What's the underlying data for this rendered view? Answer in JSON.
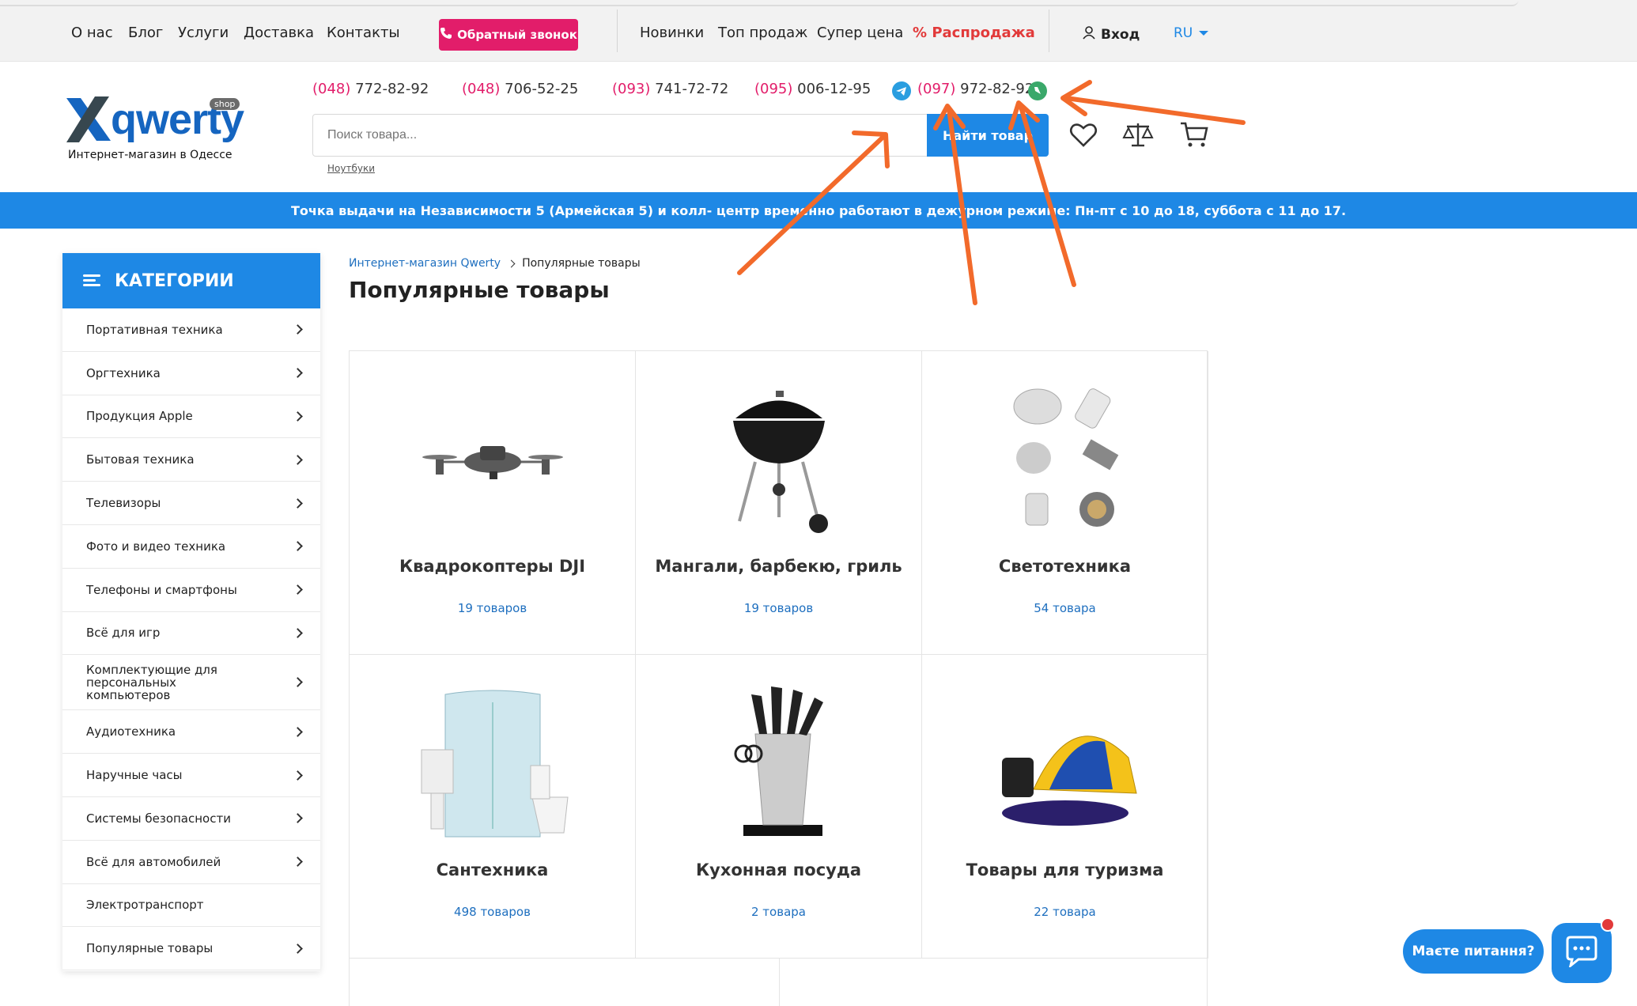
{
  "topnav": {
    "links": [
      "О нас",
      "Блог",
      "Услуги",
      "Доставка",
      "Контакты"
    ],
    "callback": "Обратный звонок",
    "links2": [
      "Новинки",
      "Топ продаж",
      "Супер цена"
    ],
    "sale": "Распродажа",
    "login": "Вход",
    "lang": "RU"
  },
  "logo": {
    "brand": "qwerty",
    "shop": "shop",
    "tagline": "Интернет-магазин в Одессе"
  },
  "phones": [
    {
      "code": "(048)",
      "number": " 772-82-92"
    },
    {
      "code": "(048)",
      "number": " 706-52-25"
    },
    {
      "code": "(093)",
      "number": " 741-72-72"
    },
    {
      "code": "(095)",
      "number": " 006-12-95"
    },
    {
      "code": "(097)",
      "number": " 972-82-92"
    }
  ],
  "search": {
    "placeholder": "Поиск товара...",
    "button": "Найти товар",
    "hint": "Ноутбуки"
  },
  "banner": "Точка выдачи на Независимости 5 (Армейская 5) и колл- центр временно работают в дежурном режиме: Пн-пт с 10 до 18, суббота с 11 до 17.",
  "sidebar": {
    "title": "КАТЕГОРИИ",
    "items": [
      "Портативная техника",
      "Оргтехника",
      "Продукция Apple",
      "Бытовая техника",
      "Телевизоры",
      "Фото и видео техника",
      "Телефоны и смартфоны",
      "Всё для игр",
      "Комплектующие для персональных компьютеров",
      "Аудиотехника",
      "Наручные часы",
      "Системы безопасности",
      "Всё для автомобилей",
      "Электротранспорт",
      "Популярные товары"
    ]
  },
  "breadcrumb": {
    "home": "Интернет-магазин Qwerty",
    "current": "Популярные товары"
  },
  "page_title": "Популярные товары",
  "cards": [
    {
      "name": "Квадрокоптеры DJI",
      "count": "19 товаров",
      "icon": "drone-image"
    },
    {
      "name": "Мангали, барбекю, гриль",
      "count": "19 товаров",
      "icon": "grill-image"
    },
    {
      "name": "Светотехника",
      "count": "54 товара",
      "icon": "lamps-image"
    },
    {
      "name": "Сантехника",
      "count": "498 товаров",
      "icon": "shower-cabin-image"
    },
    {
      "name": "Кухонная посуда",
      "count": "2 товара",
      "icon": "knife-set-image"
    },
    {
      "name": "Товары для туризма",
      "count": "22 товара",
      "icon": "tent-image"
    }
  ],
  "chat": {
    "prompt": "Маєте питання?"
  },
  "colors": {
    "accent": "#1e88e5",
    "callback": "#e21d6a",
    "sale": "#e23a3a",
    "annotation": "#f26a2b"
  }
}
